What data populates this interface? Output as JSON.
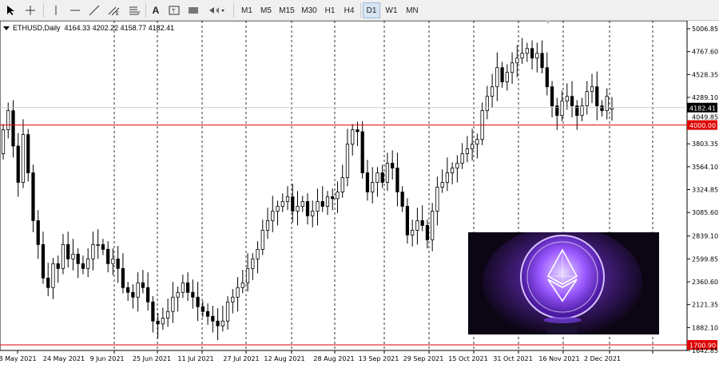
{
  "toolbar": {
    "timeframes": [
      "M1",
      "M5",
      "M15",
      "M30",
      "H1",
      "H4",
      "D1",
      "W1",
      "MN"
    ],
    "active_timeframe": "D1",
    "text_tool_label": "A"
  },
  "chart_info": {
    "symbol": "ETHUSD,Daily",
    "ohlc": "4164.33 4202.22 4158.77 4182.41"
  },
  "colors": {
    "candle": "#000000",
    "hline": "#e00000",
    "label_bg_red": "#e00000",
    "label_bg_current": "#000000",
    "grid": "#000000",
    "photo_glow": "#8a3cff"
  },
  "chart_data": {
    "type": "candlestick",
    "ylim": [
      1642.85,
      5006.85
    ],
    "y_ticks": [
      "5006.85",
      "4767.60",
      "4528.35",
      "4289.10",
      "4049.85",
      "3803.35",
      "3564.10",
      "3324.85",
      "3085.60",
      "2839.10",
      "2599.85",
      "2360.60",
      "2121.35",
      "1882.10",
      "1642.85"
    ],
    "x_ticks": [
      "8 May 2021",
      "24 May 2021",
      "9 Jun 2021",
      "25 Jun 2021",
      "11 Jul 2021",
      "27 Jul 2021",
      "12 Aug 2021",
      "28 Aug 2021",
      "13 Sep 2021",
      "29 Sep 2021",
      "15 Oct 2021",
      "31 Oct 2021",
      "16 Nov 2021",
      "2 Dec 2021"
    ],
    "horizontal_lines": [
      {
        "value": 4000.0,
        "label": "4000.00"
      },
      {
        "value": 1700.9,
        "label": "1700.90"
      }
    ],
    "current_price": {
      "value": 4182.41,
      "label": "4182.41"
    },
    "close": [
      3950,
      4150,
      3780,
      3400,
      3900,
      3500,
      3000,
      2750,
      2400,
      2300,
      2550,
      2500,
      2750,
      2600,
      2650,
      2550,
      2500,
      2600,
      2750,
      2750,
      2700,
      2550,
      2600,
      2500,
      2300,
      2250,
      2200,
      2350,
      2300,
      2150,
      1950,
      1920,
      1980,
      2050,
      2200,
      2250,
      2350,
      2250,
      2200,
      2100,
      2050,
      2000,
      1950,
      1900,
      1950,
      2150,
      2200,
      2300,
      2350,
      2500,
      2600,
      2700,
      2900,
      3000,
      3100,
      3150,
      3200,
      3250,
      3100,
      3150,
      3200,
      3050,
      3100,
      3200,
      3150,
      3250,
      3230,
      3300,
      3450,
      3800,
      3950,
      3930,
      3500,
      3300,
      3400,
      3500,
      3400,
      3600,
      3550,
      3300,
      3150,
      2850,
      2900,
      3000,
      2950,
      2800,
      3100,
      3350,
      3400,
      3500,
      3550,
      3600,
      3700,
      3750,
      3800,
      3850,
      4150,
      4300,
      4400,
      4600,
      4450,
      4550,
      4650,
      4700,
      4750,
      4800,
      4700,
      4750,
      4600,
      4400,
      4200,
      4100,
      4250,
      4300,
      4200,
      4100,
      4200,
      4350,
      4400,
      4200,
      4150,
      4300,
      4182.41
    ],
    "open": [
      3700,
      3950,
      4150,
      3780,
      3400,
      3900,
      3500,
      3000,
      2750,
      2400,
      2300,
      2550,
      2500,
      2750,
      2600,
      2650,
      2550,
      2500,
      2600,
      2750,
      2750,
      2700,
      2550,
      2600,
      2500,
      2300,
      2250,
      2200,
      2350,
      2300,
      2150,
      1950,
      1920,
      1980,
      2050,
      2200,
      2250,
      2350,
      2250,
      2200,
      2100,
      2050,
      2000,
      1950,
      1900,
      1950,
      2150,
      2200,
      2300,
      2350,
      2500,
      2600,
      2700,
      2900,
      3000,
      3100,
      3150,
      3200,
      3250,
      3100,
      3150,
      3200,
      3050,
      3100,
      3200,
      3150,
      3250,
      3230,
      3300,
      3450,
      3800,
      3950,
      3930,
      3500,
      3300,
      3400,
      3500,
      3400,
      3600,
      3550,
      3300,
      3150,
      2850,
      2900,
      3000,
      2950,
      2800,
      3100,
      3350,
      3400,
      3500,
      3550,
      3600,
      3700,
      3750,
      3800,
      3850,
      4150,
      4300,
      4400,
      4600,
      4450,
      4550,
      4650,
      4700,
      4750,
      4800,
      4700,
      4750,
      4600,
      4400,
      4200,
      4100,
      4250,
      4300,
      4200,
      4100,
      4200,
      4350,
      4400,
      4200,
      4150,
      4164.33
    ]
  }
}
